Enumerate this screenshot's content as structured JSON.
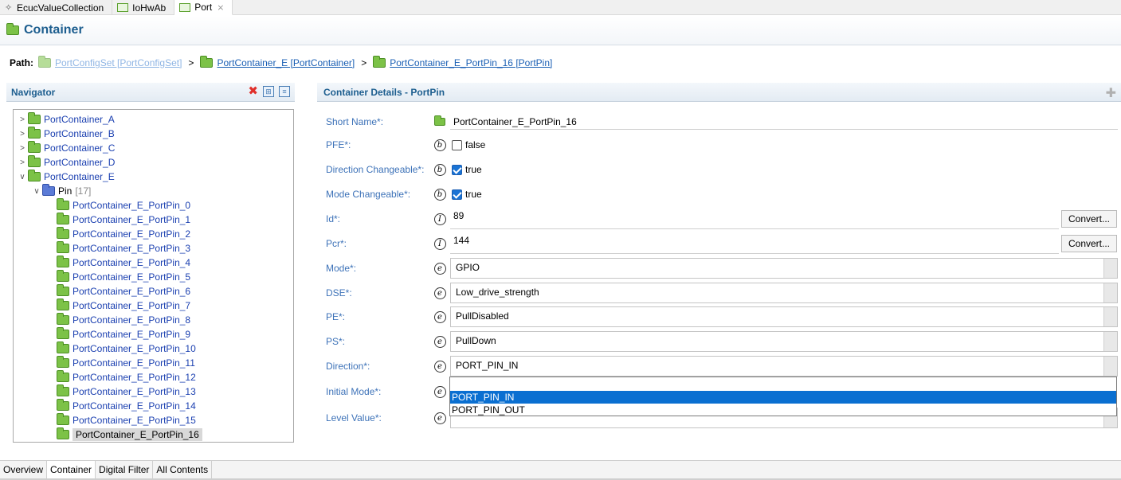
{
  "editor_tabs": [
    {
      "label": "EcucValueCollection",
      "icon": "diamond-icon"
    },
    {
      "label": "IoHwAb",
      "icon": "module-icon"
    },
    {
      "label": "Port",
      "icon": "module-icon",
      "active": true,
      "close": "⨯"
    }
  ],
  "title": "Container",
  "path": {
    "label": "Path:",
    "segments": [
      "PortConfigSet [PortConfigSet]",
      "PortContainer_E [PortContainer]",
      "PortContainer_E_PortPin_16 [PortPin]"
    ],
    "separator": ">"
  },
  "navigator": {
    "title": "Navigator",
    "containers": [
      "PortContainer_A",
      "PortContainer_B",
      "PortContainer_C",
      "PortContainer_D",
      "PortContainer_E"
    ],
    "pin_group": {
      "label": "Pin",
      "count": "[17]"
    },
    "pins": [
      "PortContainer_E_PortPin_0",
      "PortContainer_E_PortPin_1",
      "PortContainer_E_PortPin_2",
      "PortContainer_E_PortPin_3",
      "PortContainer_E_PortPin_4",
      "PortContainer_E_PortPin_5",
      "PortContainer_E_PortPin_6",
      "PortContainer_E_PortPin_7",
      "PortContainer_E_PortPin_8",
      "PortContainer_E_PortPin_9",
      "PortContainer_E_PortPin_10",
      "PortContainer_E_PortPin_11",
      "PortContainer_E_PortPin_12",
      "PortContainer_E_PortPin_13",
      "PortContainer_E_PortPin_14",
      "PortContainer_E_PortPin_15",
      "PortContainer_E_PortPin_16"
    ],
    "selected_pin": "PortContainer_E_PortPin_16"
  },
  "details": {
    "title": "Container Details - PortPin",
    "short_name": {
      "label": "Short Name*:",
      "value": "PortContainer_E_PortPin_16"
    },
    "pfe": {
      "label": "PFE*:",
      "type": "b",
      "value": "false",
      "checked": false
    },
    "direction_changeable": {
      "label": "Direction Changeable*:",
      "type": "b",
      "value": "true",
      "checked": true
    },
    "mode_changeable": {
      "label": "Mode Changeable*:",
      "type": "b",
      "value": "true",
      "checked": true
    },
    "id": {
      "label": "Id*:",
      "type": "I",
      "value": "89",
      "button": "Convert..."
    },
    "pcr": {
      "label": "Pcr*:",
      "type": "I",
      "value": "144",
      "button": "Convert..."
    },
    "mode": {
      "label": "Mode*:",
      "type": "e",
      "value": "GPIO"
    },
    "dse": {
      "label": "DSE*:",
      "type": "e",
      "value": "Low_drive_strength"
    },
    "pe": {
      "label": "PE*:",
      "type": "e",
      "value": "PullDisabled"
    },
    "ps": {
      "label": "PS*:",
      "type": "e",
      "value": "PullDown"
    },
    "direction": {
      "label": "Direction*:",
      "type": "e",
      "value": "PORT_PIN_IN"
    },
    "initial_mode": {
      "label": "Initial Mode*:",
      "type": "e"
    },
    "level_value": {
      "label": "Level Value*:",
      "type": "e"
    }
  },
  "dropdown": {
    "options": [
      "PORT_PIN_IN",
      "PORT_PIN_OUT"
    ],
    "selected": "PORT_PIN_IN"
  },
  "bottom_tabs": [
    {
      "label": "Overview"
    },
    {
      "label": "Container",
      "active": true
    },
    {
      "label": "Digital Filter"
    },
    {
      "label": "All Contents"
    }
  ]
}
